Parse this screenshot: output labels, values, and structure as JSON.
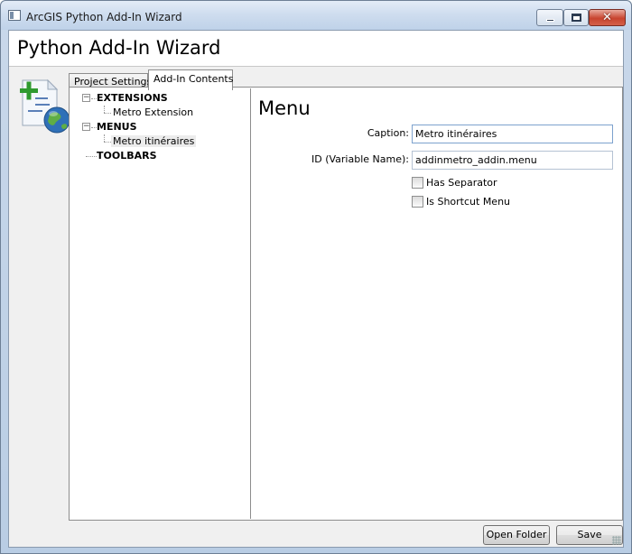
{
  "window": {
    "title": "ArcGIS Python Add-In Wizard",
    "controls": [
      "minimize",
      "maximize",
      "close"
    ]
  },
  "header": {
    "title": "Python Add-In Wizard"
  },
  "logo": {
    "icon": "addin-document-globe-icon"
  },
  "tabs": [
    {
      "label": "Project Settings",
      "selected": false
    },
    {
      "label": "Add-In Contents",
      "selected": true
    }
  ],
  "tree": {
    "groups": [
      {
        "label": "EXTENSIONS",
        "expanded": true,
        "children": [
          "Metro Extension"
        ]
      },
      {
        "label": "MENUS",
        "expanded": true,
        "children": [
          "Metro itinéraires"
        ]
      },
      {
        "label": "TOOLBARS",
        "expanded": false,
        "children": []
      }
    ],
    "selected": "Metro itinéraires"
  },
  "form": {
    "heading": "Menu",
    "caption_label": "Caption:",
    "caption_value": "Metro itinéraires",
    "id_label": "ID (Variable Name):",
    "id_value": "addinmetro_addin.menu",
    "has_separator_label": "Has Separator",
    "has_separator_checked": false,
    "is_shortcut_label": "Is Shortcut Menu",
    "is_shortcut_checked": false
  },
  "footer": {
    "open_folder_label": "Open Folder",
    "save_label": "Save"
  }
}
